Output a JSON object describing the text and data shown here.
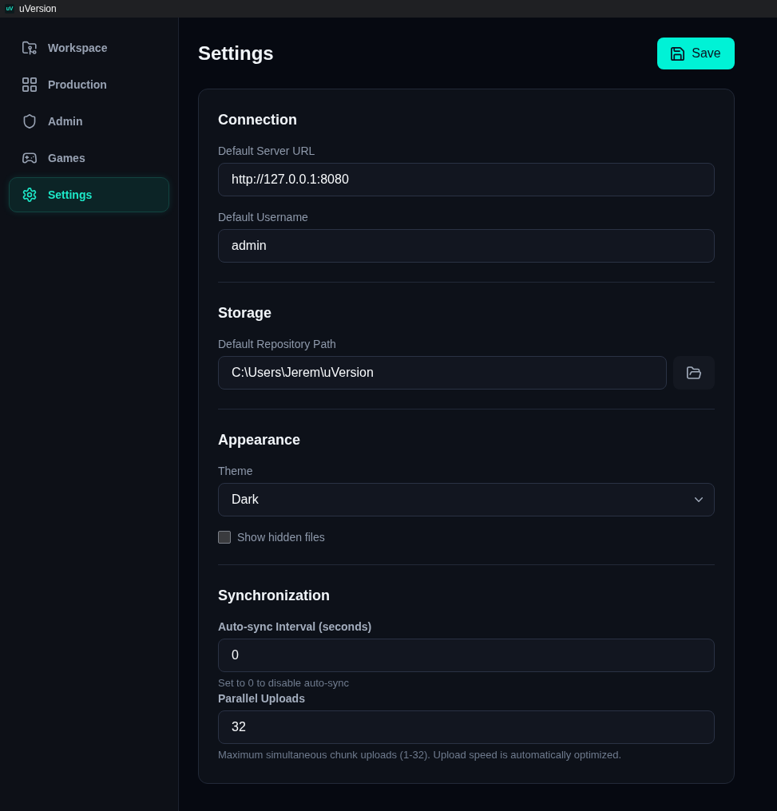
{
  "window": {
    "logo": "uV",
    "title": "uVersion"
  },
  "sidebar": {
    "items": [
      {
        "label": "Workspace",
        "selected": false
      },
      {
        "label": "Production",
        "selected": false
      },
      {
        "label": "Admin",
        "selected": false
      },
      {
        "label": "Games",
        "selected": false
      },
      {
        "label": "Settings",
        "selected": true
      }
    ]
  },
  "header": {
    "title": "Settings",
    "save_button": "Save"
  },
  "sections": [
    {
      "title": "Connection",
      "fields": [
        {
          "kind": "text",
          "label": "Default Server URL",
          "value": "http://127.0.0.1:8080"
        },
        {
          "kind": "text",
          "label": "Default Username",
          "value": "admin"
        }
      ]
    },
    {
      "title": "Storage",
      "fields": [
        {
          "kind": "path",
          "label": "Default Repository Path",
          "value": "C:\\Users\\Jerem\\uVersion"
        }
      ]
    },
    {
      "title": "Appearance",
      "fields": [
        {
          "kind": "select",
          "label": "Theme",
          "value": "Dark"
        },
        {
          "kind": "checkbox",
          "label": "Show hidden files",
          "checked": false
        }
      ]
    },
    {
      "title": "Synchronization",
      "fields": [
        {
          "kind": "number",
          "label": "Auto-sync Interval (seconds)",
          "value": "0",
          "hint": "Set to 0 to disable auto-sync"
        },
        {
          "kind": "number",
          "label": "Parallel Uploads",
          "value": "32",
          "hint": "Maximum simultaneous chunk uploads (1-32). Upload speed is automatically optimized."
        }
      ]
    }
  ]
}
